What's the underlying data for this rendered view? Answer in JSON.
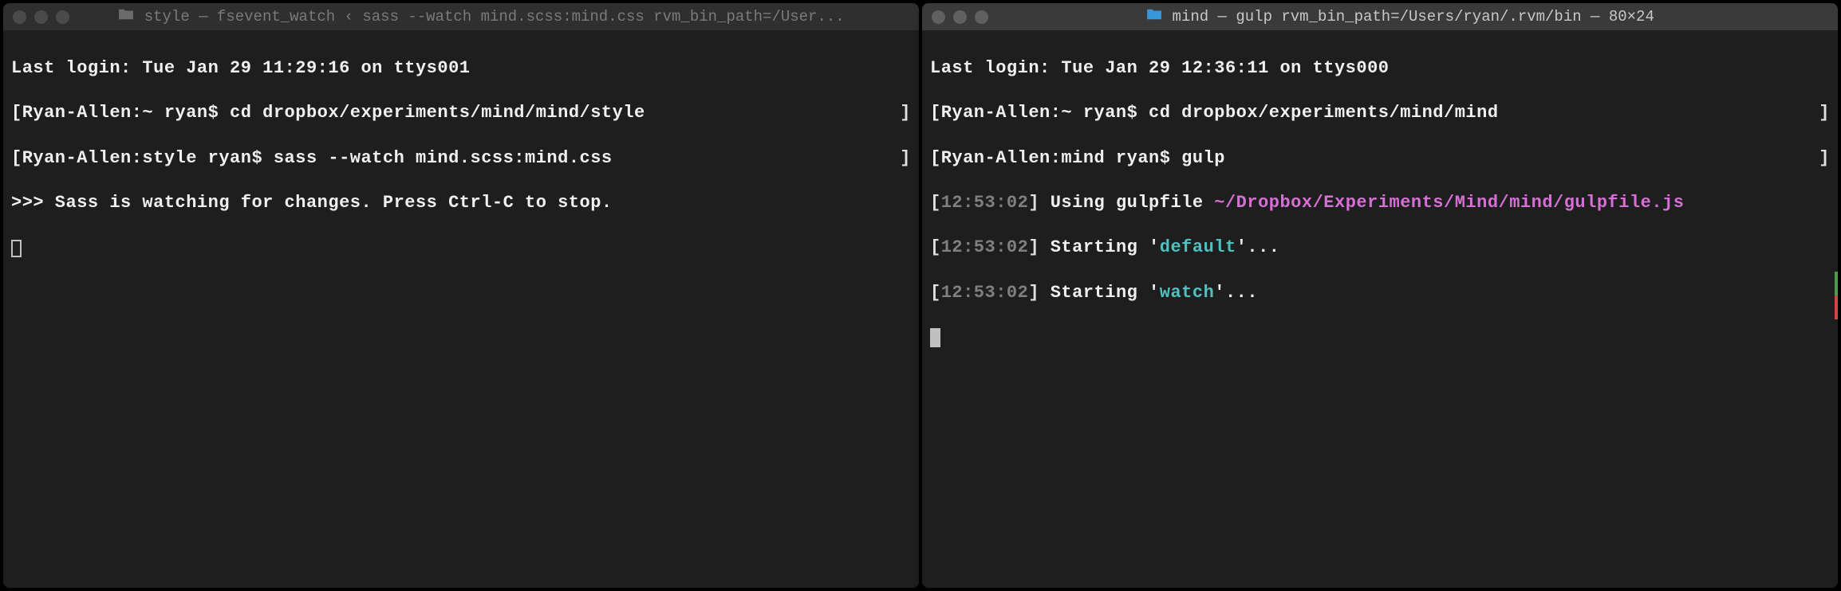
{
  "left_terminal": {
    "title": "style — fsevent_watch ‹ sass --watch mind.scss:mind.css rvm_bin_path=/User...",
    "lines": {
      "login": "Last login: Tue Jan 29 11:29:16 on ttys001",
      "prompt1_prefix": "[Ryan-Allen:~ ryan$ ",
      "cmd1": "cd dropbox/experiments/mind/mind/style",
      "prompt2_prefix": "[Ryan-Allen:style ryan$ ",
      "cmd2": "sass --watch mind.scss:mind.css",
      "output1": ">>> Sass is watching for changes. Press Ctrl-C to stop.",
      "bracket": "]"
    }
  },
  "right_terminal": {
    "title": "mind — gulp rvm_bin_path=/Users/ryan/.rvm/bin — 80×24",
    "lines": {
      "login": "Last login: Tue Jan 29 12:36:11 on ttys000",
      "prompt1_prefix": "[Ryan-Allen:~ ryan$ ",
      "cmd1": "cd dropbox/experiments/mind/mind",
      "prompt2_prefix": "[Ryan-Allen:mind ryan$ ",
      "cmd2": "gulp",
      "ts1": "12:53:02",
      "gulpfile_text": " Using gulpfile ",
      "gulpfile_path": "~/Dropbox/Experiments/Mind/mind/gulpfile.js",
      "ts2": "12:53:02",
      "starting_text": " Starting '",
      "task_default": "default",
      "ts3": "12:53:02",
      "task_watch": "watch",
      "ellipsis": "'...",
      "bracket": "]",
      "lbracket": "["
    }
  }
}
